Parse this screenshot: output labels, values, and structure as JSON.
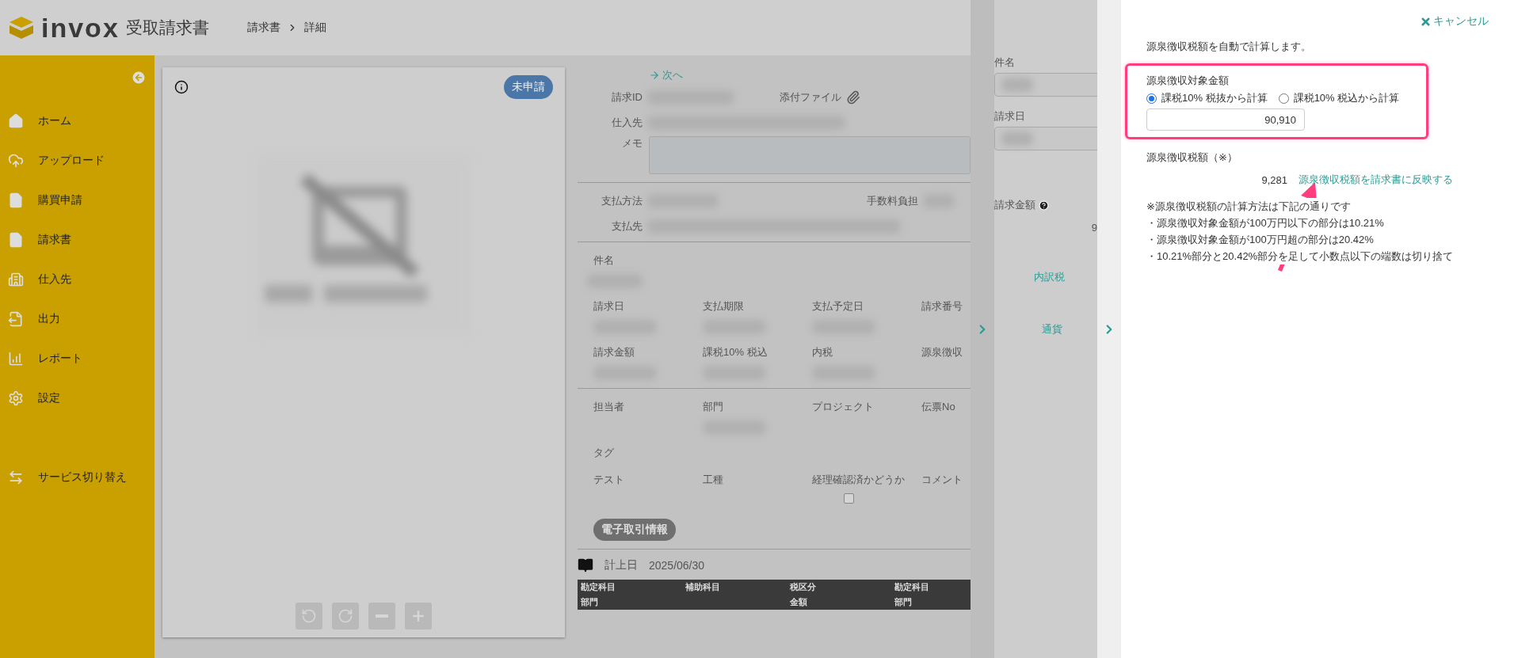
{
  "header": {
    "logo": "invox",
    "product": "受取請求書",
    "breadcrumb": [
      "請求書",
      "詳細"
    ]
  },
  "sidebar": {
    "items": [
      {
        "kind": "home",
        "label": "ホーム"
      },
      {
        "kind": "upload",
        "label": "アップロード"
      },
      {
        "kind": "file",
        "label": "購買申請"
      },
      {
        "kind": "file",
        "label": "請求書"
      },
      {
        "kind": "building",
        "label": "仕入先"
      },
      {
        "kind": "export",
        "label": "出力"
      },
      {
        "kind": "chart",
        "label": "レポート"
      },
      {
        "kind": "gear",
        "label": "設定"
      }
    ],
    "footer_items": [
      {
        "kind": "switch",
        "label": "サービス切り替え"
      }
    ]
  },
  "document": {
    "status": "未申請"
  },
  "detail": {
    "next_link": "次へ",
    "invoice_id_label": "請求ID",
    "attachment_label": "添付ファイル",
    "supplier_label": "仕入先",
    "memo_label": "メモ",
    "payment_method_label": "支払方法",
    "fee_label": "手数料負担",
    "payee_label": "支払先",
    "subject_label": "件名",
    "grid_sections": [
      [
        [
          {
            "label": "請求日",
            "blurred": true
          },
          {
            "label": "支払期限",
            "blurred": true
          },
          {
            "label": "支払予定日",
            "blurred": true
          },
          {
            "label": "請求番号"
          }
        ],
        [
          {
            "label": "請求金額",
            "blurred": true
          },
          {
            "label": "課税10% 税込",
            "blurred": true
          },
          {
            "label": "内税",
            "blurred": true
          },
          {
            "label": "源泉徴収"
          }
        ]
      ],
      [
        [
          {
            "label": "担当者"
          },
          {
            "label": "部門",
            "blurred": true
          },
          {
            "label": "プロジェクト"
          },
          {
            "label": "伝票No"
          }
        ],
        [
          {
            "label": "タグ"
          }
        ],
        [
          {
            "label": "テスト"
          },
          {
            "label": "工種"
          },
          {
            "label": "経理確認済かどうか",
            "checkbox": {
              "checked": false
            }
          },
          {
            "label": "コメント"
          }
        ]
      ]
    ],
    "e_trade_button": "電子取引情報",
    "booking_date_label": "計上日",
    "booking_date": "2025/06/30",
    "table_columns": [
      {
        "top": "勘定科目",
        "bottom": "部門"
      },
      {
        "top": "補助科目"
      },
      {
        "top": "税区分",
        "bottom": "金額"
      },
      {
        "top": "勘定科目",
        "bottom": "部門"
      }
    ]
  },
  "middle_panel": {
    "fields": [
      {
        "label": "件名"
      },
      {
        "label": "請求日"
      }
    ],
    "amount_label": "請求金額",
    "amount_partial": "9",
    "links": [
      "内訳税",
      "通貨"
    ]
  },
  "withholding_panel": {
    "cancel": "キャンセル",
    "intro": "源泉徴収税額を自動で計算します。",
    "target_label": "源泉徴収対象金額",
    "options": [
      {
        "label": "課税10% 税抜から計算",
        "selected": true
      },
      {
        "label": "課税10% 税込から計算",
        "selected": false
      }
    ],
    "amount": "90,910",
    "tax_label": "源泉徴収税額（※）",
    "tax_value": "9,281",
    "apply_link": "源泉徴収税額を請求書に反映する",
    "notes": [
      "※源泉徴収税額の計算方法は下記の通りです",
      "・源泉徴収対象金額が100万円以下の部分は10.21%",
      "・源泉徴収対象金額が100万円超の部分は20.42%",
      "・10.21%部分と20.42%部分を足して小数点以下の端数は切り捨て"
    ]
  }
}
